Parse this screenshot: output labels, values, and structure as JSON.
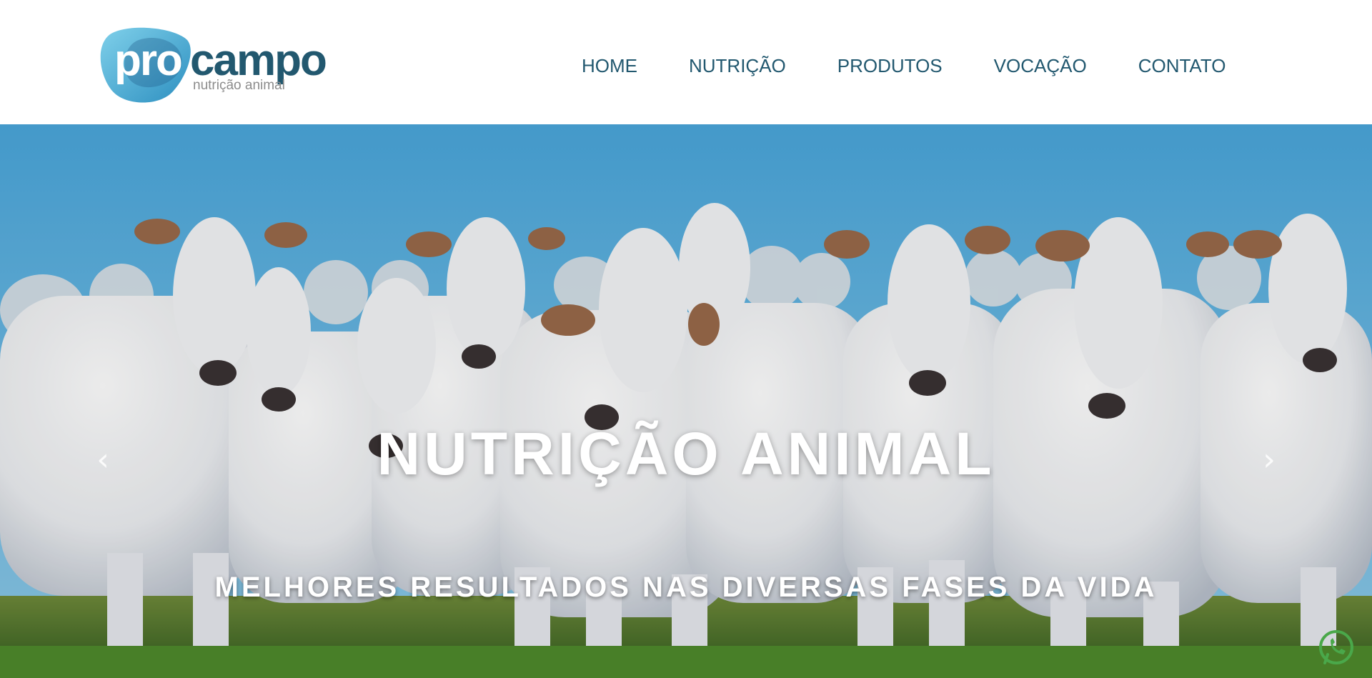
{
  "logo": {
    "pro": "pro",
    "campo": "campo",
    "subtitle": "nutrição animal"
  },
  "nav": {
    "items": [
      {
        "label": "HOME"
      },
      {
        "label": "NUTRIÇÃO"
      },
      {
        "label": "PRODUTOS"
      },
      {
        "label": "VOCAÇÃO"
      },
      {
        "label": "CONTATO"
      }
    ]
  },
  "hero": {
    "title": "NUTRIÇÃO ANIMAL",
    "subtitle": "MELHORES RESULTADOS NAS DIVERSAS FASES DA VIDA",
    "prev_icon": "chevron-left-icon",
    "next_icon": "chevron-right-icon",
    "prev_glyph": "‹",
    "next_glyph": "›"
  },
  "colors": {
    "brand_dark": "#22586f",
    "brand_light": "#4fb3d9",
    "sky": "#5fb2de",
    "grass": "#3c6b2a",
    "whatsapp": "#4aa84a"
  },
  "whatsapp": {
    "icon": "whatsapp-icon"
  }
}
